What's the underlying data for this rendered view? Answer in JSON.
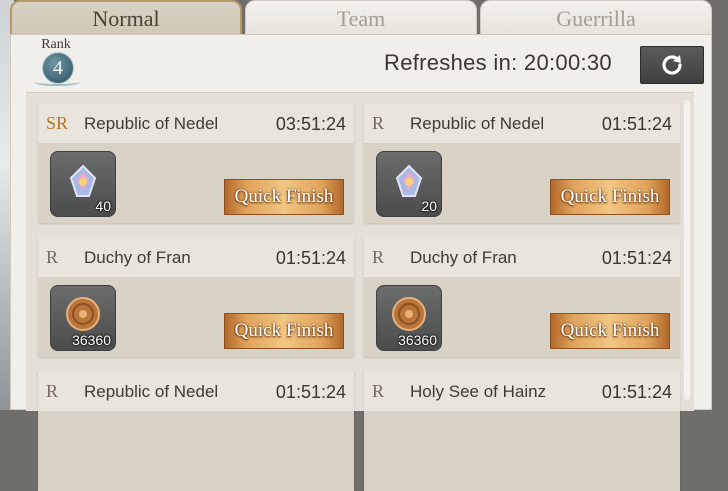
{
  "tabs": [
    {
      "label": "Normal",
      "active": true
    },
    {
      "label": "Team",
      "active": false
    },
    {
      "label": "Guerrilla",
      "active": false
    }
  ],
  "rank": {
    "label": "Rank",
    "value": "4"
  },
  "refresh": {
    "text": "Refreshes in: 20:00:30",
    "icon": "refresh-icon"
  },
  "missions": [
    {
      "rarity": "SR",
      "name": "Republic of Nedel",
      "timer": "03:51:24",
      "reward_icon": "crystal-icon",
      "reward_count": "40",
      "button": "Quick Finish"
    },
    {
      "rarity": "R",
      "name": "Republic of Nedel",
      "timer": "01:51:24",
      "reward_icon": "crystal-icon",
      "reward_count": "20",
      "button": "Quick Finish"
    },
    {
      "rarity": "R",
      "name": "Duchy of Fran",
      "timer": "01:51:24",
      "reward_icon": "coin-icon",
      "reward_count": "36360",
      "button": "Quick Finish"
    },
    {
      "rarity": "R",
      "name": "Duchy of Fran",
      "timer": "01:51:24",
      "reward_icon": "coin-icon",
      "reward_count": "36360",
      "button": "Quick Finish"
    },
    {
      "rarity": "R",
      "name": "Republic of Nedel",
      "timer": "01:51:24",
      "reward_icon": "",
      "reward_count": "",
      "button": ""
    },
    {
      "rarity": "R",
      "name": "Holy See of Hainz",
      "timer": "01:51:24",
      "reward_icon": "",
      "reward_count": "",
      "button": ""
    }
  ],
  "colors": {
    "accent_gold": "#e0a25a",
    "sr_rarity": "#b9752a",
    "panel_bg": "#f1efe9"
  }
}
